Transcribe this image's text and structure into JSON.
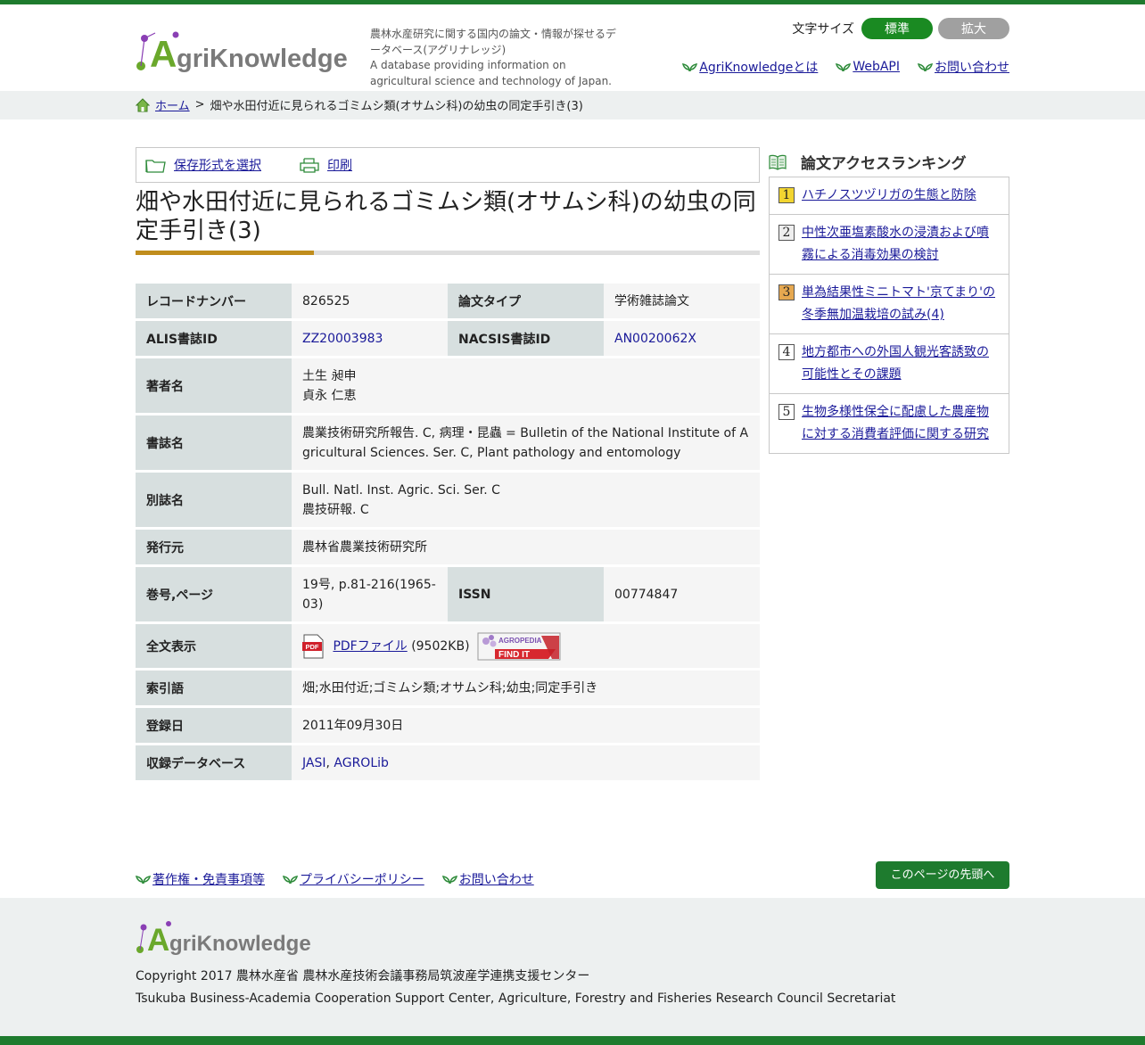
{
  "header": {
    "logo_text": "AgriKnowledge",
    "tagline_ja": "農林水産研究に関する国内の論文・情報が探せるデータベース(アグリナレッジ)",
    "tagline_en": "A database providing information on agricultural science and technology of Japan.",
    "font_size_label": "文字サイズ",
    "font_size_standard": "標準",
    "font_size_large": "拡大",
    "nav": [
      "AgriKnowledgeとは",
      "WebAPI",
      "お問い合わせ"
    ]
  },
  "breadcrumb": {
    "home": "ホーム",
    "separator": ">",
    "current": "畑や水田付近に見られるゴミムシ類(オサムシ科)の幼虫の同定手引き(3)"
  },
  "toolbar": {
    "save_label": "保存形式を選択",
    "print_label": "印刷"
  },
  "article": {
    "title": "畑や水田付近に見られるゴミムシ類(オサムシ科)の幼虫の同定手引き(3)",
    "record_number_label": "レコードナンバー",
    "record_number": "826525",
    "paper_type_label": "論文タイプ",
    "paper_type": "学術雑誌論文",
    "alis_label": "ALIS書誌ID",
    "alis_id": "ZZ20003983",
    "nacsis_label": "NACSIS書誌ID",
    "nacsis_id": "AN0020062X",
    "authors_label": "著者名",
    "author_1": "土生 昶申",
    "author_2": "貞永 仁恵",
    "journal_label": "書誌名",
    "journal": "農業技術研究所報告. C, 病理・昆蟲 = Bulletin of the National Institute of Agricultural Sciences. Ser. C, Plant pathology and entomology",
    "alt_journal_label": "別誌名",
    "alt_journal_1": "Bull. Natl. Inst. Agric. Sci. Ser. C",
    "alt_journal_2": "農技研報. C",
    "publisher_label": "発行元",
    "publisher": "農林省農業技術研究所",
    "volume_label": "巻号,ページ",
    "volume": "19号, p.81-216(1965-03)",
    "issn_label": "ISSN",
    "issn": "00774847",
    "fulltext_label": "全文表示",
    "pdf_link": "PDFファイル",
    "pdf_size": "(9502KB)",
    "pdf_icon_text": "PDF",
    "findit_brand": "AGROPEDIA",
    "findit_text": "FIND IT",
    "keywords_label": "索引語",
    "keywords": "畑;水田付近;ゴミムシ類;オサムシ科;幼虫;同定手引き",
    "registered_label": "登録日",
    "registered": "2011年09月30日",
    "database_label": "収録データベース",
    "db_1": "JASI",
    "db_sep": ", ",
    "db_2": "AGROLib"
  },
  "ranking": {
    "title": "論文アクセスランキング",
    "items": [
      {
        "rank": "1",
        "title": "ハチノスツヅリガの生態と防除"
      },
      {
        "rank": "2",
        "title": "中性次亜塩素酸水の浸漬および噴霧による消毒効果の検討"
      },
      {
        "rank": "3",
        "title": "単為結果性ミニトマト'京てまり'の冬季無加温栽培の試み(4)"
      },
      {
        "rank": "4",
        "title": "地方都市への外国人観光客誘致の可能性とその課題"
      },
      {
        "rank": "5",
        "title": "生物多様性保全に配慮した農産物に対する消費者評価に関する研究"
      }
    ]
  },
  "footer": {
    "links": [
      "著作権・免責事項等",
      "プライバシーポリシー",
      "お問い合わせ"
    ],
    "to_top": "このページの先頭へ",
    "copyright_ja": "Copyright 2017 農林水産省 農林水産技術会議事務局筑波産学連携支援センター",
    "copyright_en": "Tsukuba Business-Academia Cooperation Support Center, Agriculture, Forestry and Fisheries Research Council Secretariat"
  },
  "colors": {
    "brand_green": "#1e7b2e",
    "accent_gold": "#c08d1d",
    "label_bg": "#d7dfdf"
  }
}
